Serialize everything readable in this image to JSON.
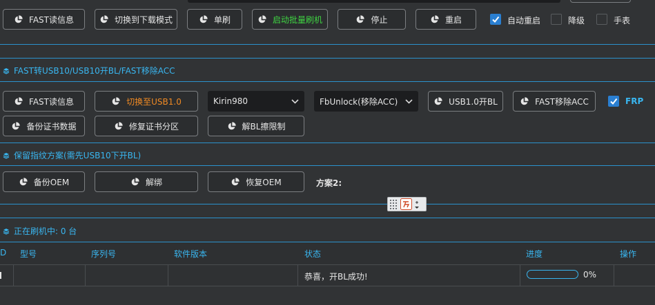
{
  "row1": {
    "fast_read": "FAST读信息",
    "switch_download": "切换到下载模式",
    "single_flash": "单刷",
    "batch_flash": "启动批量刷机",
    "stop": "停止",
    "restart": "重启",
    "auto_restart": {
      "label": "自动重启",
      "checked": true
    },
    "downgrade": {
      "label": "降级",
      "checked": false
    },
    "watch": {
      "label": "手表",
      "checked": false
    }
  },
  "section1": {
    "title": "FAST转USB10/USB10开BL/FAST移除ACC",
    "fast_read": "FAST读信息",
    "switch_usb": "切换至USB1.0",
    "chip_select": "Kirin980",
    "mode_select": "FbUnlock(移除ACC)",
    "usb_unlock": "USB1.0开BL",
    "fast_remove_acc": "FAST移除ACC",
    "frp": {
      "label": "FRP",
      "checked": true
    },
    "backup_cert": "备份证书数据",
    "repair_cert": "修复证书分区",
    "unlock_bl": "解BL擦限制"
  },
  "section2": {
    "title": "保留指纹方案(需先USB10下开BL)",
    "backup_oem": "备份OEM",
    "unbind": "解绑",
    "restore_oem": "恢复OEM",
    "plan2": "方案2:"
  },
  "section3": {
    "title": "正在刷机中:  0 台"
  },
  "table": {
    "headers": [
      "D",
      "型号",
      "序列号",
      "软件版本",
      "状态",
      "进度",
      "操作"
    ],
    "rows": [
      {
        "status": "恭喜，开BL成功!",
        "progress_text": "0%",
        "progress": 0
      }
    ]
  },
  "colors": {
    "accent": "#39b6f0",
    "green": "#3fd442",
    "orange": "#f08a24",
    "check": "#2a7fd1"
  }
}
